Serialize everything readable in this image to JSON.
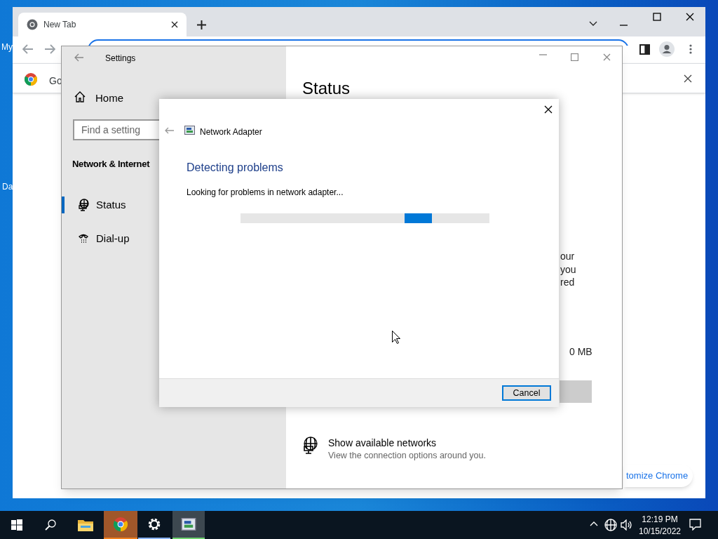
{
  "desktop_icons": [
    "My",
    "Da"
  ],
  "browser": {
    "tab": {
      "title": "New Tab"
    },
    "infobar_text": "Go",
    "customize_button": "tomize Chrome"
  },
  "settings": {
    "title": "Settings",
    "home": "Home",
    "search": {
      "placeholder": "Find a setting"
    },
    "section": "Network & Internet",
    "nav": [
      {
        "label": "Status",
        "kind": "status",
        "selected": true
      },
      {
        "label": "Dial-up",
        "kind": "dialup",
        "selected": false
      }
    ],
    "heading": "Status",
    "partial_lines": [
      "our",
      "you",
      "red"
    ],
    "data_usage": "0 MB",
    "networks_link": {
      "title": "Show available networks",
      "subtitle": "View the connection options around you."
    }
  },
  "dialog": {
    "title": "Network Adapter",
    "heading": "Detecting problems",
    "message": "Looking for problems in network adapter...",
    "button": "Cancel"
  },
  "taskbar": {
    "time": "12:19 PM",
    "date": "10/15/2022"
  }
}
